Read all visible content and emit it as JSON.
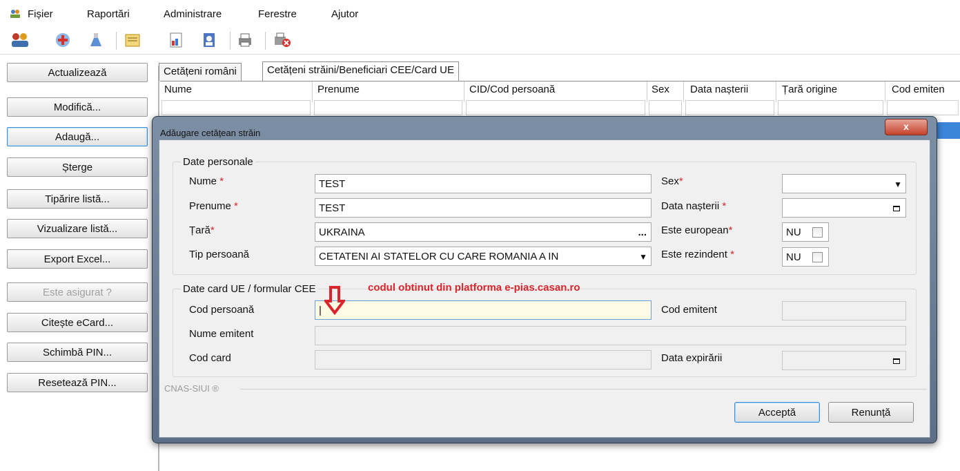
{
  "menu": [
    "Fișier",
    "Raportări",
    "Administrare",
    "Ferestre",
    "Ajutor"
  ],
  "side_buttons": [
    "Actualizează",
    "Modifică...",
    "Adaugă...",
    "Șterge",
    "Tipărire listă...",
    "Vizualizare listă...",
    "Export Excel...",
    "Este asigurat ?",
    "Citește eCard...",
    "Schimbă PIN...",
    "Resetează PIN..."
  ],
  "tabs": [
    "Cetățeni români",
    "Cetățeni străini/Beneficiari CEE/Card UE"
  ],
  "columns": [
    "Nume",
    "Prenume",
    "CID/Cod persoană",
    "Sex",
    "Data nașterii",
    "Țară origine",
    "Cod emiten"
  ],
  "dialog": {
    "title": "Adăugare cetățean străin",
    "close": "x",
    "personal_group": "Date personale",
    "nume_label": "Nume",
    "nume_value": "TEST",
    "prenume_label": "Prenume",
    "prenume_value": "TEST",
    "tara_label": "Țară",
    "tara_value": "UKRAINA",
    "tip_label": "Tip persoană",
    "tip_value": "CETATENI AI STATELOR CU CARE ROMANIA A IN",
    "sex_label": "Sex",
    "sex_value": "",
    "data_nasterii_label": "Data nașterii",
    "european_label": "Este european",
    "european_value": "NU",
    "rezident_label": "Este rezindent",
    "rezident_value": "NU",
    "card_group": "Date card UE / formular CEE",
    "cod_persoana_label": "Cod persoană",
    "cod_persoana_value": "|",
    "cod_emitent_label": "Cod emitent",
    "nume_emitent_label": "Nume emitent",
    "cod_card_label": "Cod card",
    "data_expirarii_label": "Data expirării",
    "footer": "CNAS-SIUI ®",
    "accept": "Acceptă",
    "cancel": "Renunță",
    "required_mark": "*"
  },
  "annotation": "codul obtinut din platforma e-pias.casan.ro",
  "colors": {
    "accent": "#3c86d8",
    "required": "#d9262c",
    "annotation_arrow": "#d9262c"
  }
}
